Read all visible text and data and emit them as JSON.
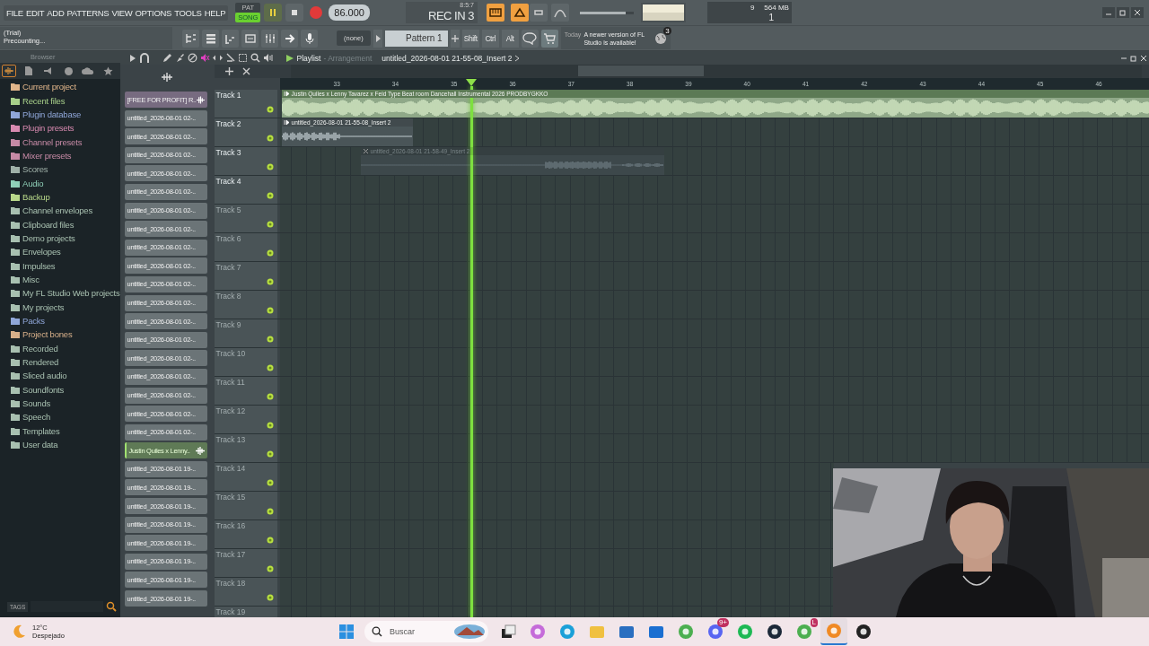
{
  "menu": [
    "FILE",
    "EDIT",
    "ADD",
    "PATTERNS",
    "VIEW",
    "OPTIONS",
    "TOOLS",
    "HELP"
  ],
  "transport": {
    "modes": [
      {
        "label": "PAT",
        "selected": false
      },
      {
        "label": "SONG",
        "selected": true
      }
    ],
    "playing": true,
    "recording": true,
    "tempo": "86.000"
  },
  "master_volume": {
    "level": 0.85
  },
  "time_display": {
    "position": "8:5:7",
    "text": "REC IN 3"
  },
  "resources": {
    "cpu": "9",
    "memory": "564 MB",
    "polyphony": "1"
  },
  "hint": {
    "line_1": "(Trial)",
    "line_2": "Precounting..."
  },
  "pattern_selector": {
    "channel": "(none)",
    "pattern": "Pattern 1"
  },
  "modifier_keys": [
    "Shift",
    "Ctrl",
    "Alt"
  ],
  "news": {
    "date": "Today",
    "message": "A newer version of FL Studio is available!",
    "badge": "3"
  },
  "browser": {
    "title": "Browser",
    "tags_label": "TAGS",
    "tabs": [
      {
        "kind": "audio",
        "selected": true
      },
      {
        "kind": "files",
        "selected": false
      },
      {
        "kind": "plugins",
        "selected": false
      },
      {
        "kind": "web",
        "selected": false
      },
      {
        "kind": "cloud",
        "selected": false
      },
      {
        "kind": "favorites",
        "selected": false
      }
    ],
    "items": [
      {
        "label": "Current project",
        "color": "#e0b58a"
      },
      {
        "label": "Recent files",
        "color": "#a8d08a"
      },
      {
        "label": "Plugin database",
        "color": "#8fa6d8"
      },
      {
        "label": "Plugin presets",
        "color": "#d88ab0"
      },
      {
        "label": "Channel presets",
        "color": "#c68aa6"
      },
      {
        "label": "Mixer presets",
        "color": "#c68aa6"
      },
      {
        "label": "Scores",
        "color": "#9fb0a8"
      },
      {
        "label": "Audio",
        "color": "#8fd0b8"
      },
      {
        "label": "Backup",
        "color": "#b8d88a"
      },
      {
        "label": "Channel envelopes",
        "color": "#a8c0b0"
      },
      {
        "label": "Clipboard files",
        "color": "#a8c0b0"
      },
      {
        "label": "Demo projects",
        "color": "#a8c0b0"
      },
      {
        "label": "Envelopes",
        "color": "#a8c0b0"
      },
      {
        "label": "Impulses",
        "color": "#a8c0b0"
      },
      {
        "label": "Misc",
        "color": "#a8c0b0"
      },
      {
        "label": "My FL Studio Web projects",
        "color": "#a8c0b0"
      },
      {
        "label": "My projects",
        "color": "#a8c0b0"
      },
      {
        "label": "Packs",
        "color": "#8fa6d8"
      },
      {
        "label": "Project bones",
        "color": "#d8b08a"
      },
      {
        "label": "Recorded",
        "color": "#a8c0b0"
      },
      {
        "label": "Rendered",
        "color": "#a8c0b0"
      },
      {
        "label": "Sliced audio",
        "color": "#a8c0b0"
      },
      {
        "label": "Soundfonts",
        "color": "#a8c0b0"
      },
      {
        "label": "Sounds",
        "color": "#a8c0b0"
      },
      {
        "label": "Speech",
        "color": "#a8c0b0"
      },
      {
        "label": "Templates",
        "color": "#a8c0b0"
      },
      {
        "label": "User data",
        "color": "#a8c0b0"
      }
    ]
  },
  "playlist": {
    "title": "Playlist",
    "view": "- Arrangement",
    "pattern_name": "untitled_2026-08-01 21-55-08_Insert 2",
    "bars": [
      "33",
      "34",
      "35",
      "36",
      "37",
      "38",
      "39",
      "40",
      "41",
      "42",
      "43",
      "44",
      "45",
      "46"
    ],
    "picker": [
      {
        "label": "[FREE FOR PROFIT] R..",
        "kind": "pattern",
        "selected": false
      },
      {
        "label": "untitled_2026-08-01 02-..",
        "kind": "audio",
        "selected": false
      },
      {
        "label": "untitled_2026-08-01 02-..",
        "kind": "audio",
        "selected": false
      },
      {
        "label": "untitled_2026-08-01 02-..",
        "kind": "audio",
        "selected": false
      },
      {
        "label": "untitled_2026-08-01 02-..",
        "kind": "audio",
        "selected": false
      },
      {
        "label": "untitled_2026-08-01 02-..",
        "kind": "audio",
        "selected": false
      },
      {
        "label": "untitled_2026-08-01 02-..",
        "kind": "audio",
        "selected": false
      },
      {
        "label": "untitled_2026-08-01 02-..",
        "kind": "audio",
        "selected": false
      },
      {
        "label": "untitled_2026-08-01 02-..",
        "kind": "audio",
        "selected": false
      },
      {
        "label": "untitled_2026-08-01 02-..",
        "kind": "audio",
        "selected": false
      },
      {
        "label": "untitled_2026-08-01 02-..",
        "kind": "audio",
        "selected": false
      },
      {
        "label": "untitled_2026-08-01 02-..",
        "kind": "audio",
        "selected": false
      },
      {
        "label": "untitled_2026-08-01 02-..",
        "kind": "audio",
        "selected": false
      },
      {
        "label": "untitled_2026-08-01 02-..",
        "kind": "audio",
        "selected": false
      },
      {
        "label": "untitled_2026-08-01 02-..",
        "kind": "audio",
        "selected": false
      },
      {
        "label": "untitled_2026-08-01 02-..",
        "kind": "audio",
        "selected": false
      },
      {
        "label": "untitled_2026-08-01 02-..",
        "kind": "audio",
        "selected": false
      },
      {
        "label": "untitled_2026-08-01 02-..",
        "kind": "audio",
        "selected": false
      },
      {
        "label": "untitled_2026-08-01 02-..",
        "kind": "audio",
        "selected": false
      },
      {
        "label": "Justin Quiles x Lenny..",
        "kind": "audio",
        "selected": true
      },
      {
        "label": "untitled_2026-08-01 19-..",
        "kind": "audio",
        "selected": false
      },
      {
        "label": "untitled_2026-08-01 19-..",
        "kind": "audio",
        "selected": false
      },
      {
        "label": "untitled_2026-08-01 19-..",
        "kind": "audio",
        "selected": false
      },
      {
        "label": "untitled_2026-08-01 19-..",
        "kind": "audio",
        "selected": false
      },
      {
        "label": "untitled_2026-08-01 19-..",
        "kind": "audio",
        "selected": false
      },
      {
        "label": "untitled_2026-08-01 19-..",
        "kind": "audio",
        "selected": false
      },
      {
        "label": "untitled_2026-08-01 19-..",
        "kind": "audio",
        "selected": false
      },
      {
        "label": "untitled_2026-08-01 19-..",
        "kind": "audio",
        "selected": false
      }
    ],
    "tracks": [
      {
        "name": "Track 1",
        "active": true,
        "clip": {
          "label": "Justin Quiles x Lenny Tavarez x Feid Type Beat room Dancehall Instrumental 2026  PRODBYGKKO",
          "muted": false
        }
      },
      {
        "name": "Track 2",
        "active": true,
        "clip": {
          "label": "untitled_2026-08-01 21-55-08_Insert 2",
          "muted": false
        }
      },
      {
        "name": "Track 3",
        "active": true,
        "clip": {
          "label": "untitled_2026-08-01 21-58-49_Insert 2",
          "muted": true
        }
      },
      {
        "name": "Track 4",
        "active": true
      },
      {
        "name": "Track 5",
        "active": false
      },
      {
        "name": "Track 6",
        "active": false
      },
      {
        "name": "Track 7",
        "active": false
      },
      {
        "name": "Track 8",
        "active": false
      },
      {
        "name": "Track 9",
        "active": false
      },
      {
        "name": "Track 10",
        "active": false
      },
      {
        "name": "Track 11",
        "active": false
      },
      {
        "name": "Track 12",
        "active": false
      },
      {
        "name": "Track 13",
        "active": false
      },
      {
        "name": "Track 14",
        "active": false
      },
      {
        "name": "Track 15",
        "active": false
      },
      {
        "name": "Track 16",
        "active": false
      },
      {
        "name": "Track 17",
        "active": false
      },
      {
        "name": "Track 18",
        "active": false
      },
      {
        "name": "Track 19",
        "active": false
      }
    ]
  },
  "taskbar": {
    "weather": {
      "temperature": "12°C",
      "condition": "Despejado"
    },
    "search_placeholder": "Buscar",
    "apps": [
      {
        "kind": "taskview",
        "active": false
      },
      {
        "kind": "copilot",
        "active": false
      },
      {
        "kind": "edge",
        "active": false
      },
      {
        "kind": "folder",
        "active": false
      },
      {
        "kind": "store",
        "active": false
      },
      {
        "kind": "mail",
        "active": false
      },
      {
        "kind": "chrome",
        "active": false
      },
      {
        "kind": "discord",
        "active": false,
        "badge": "9+"
      },
      {
        "kind": "spotify",
        "active": false
      },
      {
        "kind": "steam",
        "active": false
      },
      {
        "kind": "chrome",
        "active": false,
        "badge": "L"
      },
      {
        "kind": "fl",
        "active": true
      },
      {
        "kind": "obs",
        "active": false
      }
    ]
  }
}
